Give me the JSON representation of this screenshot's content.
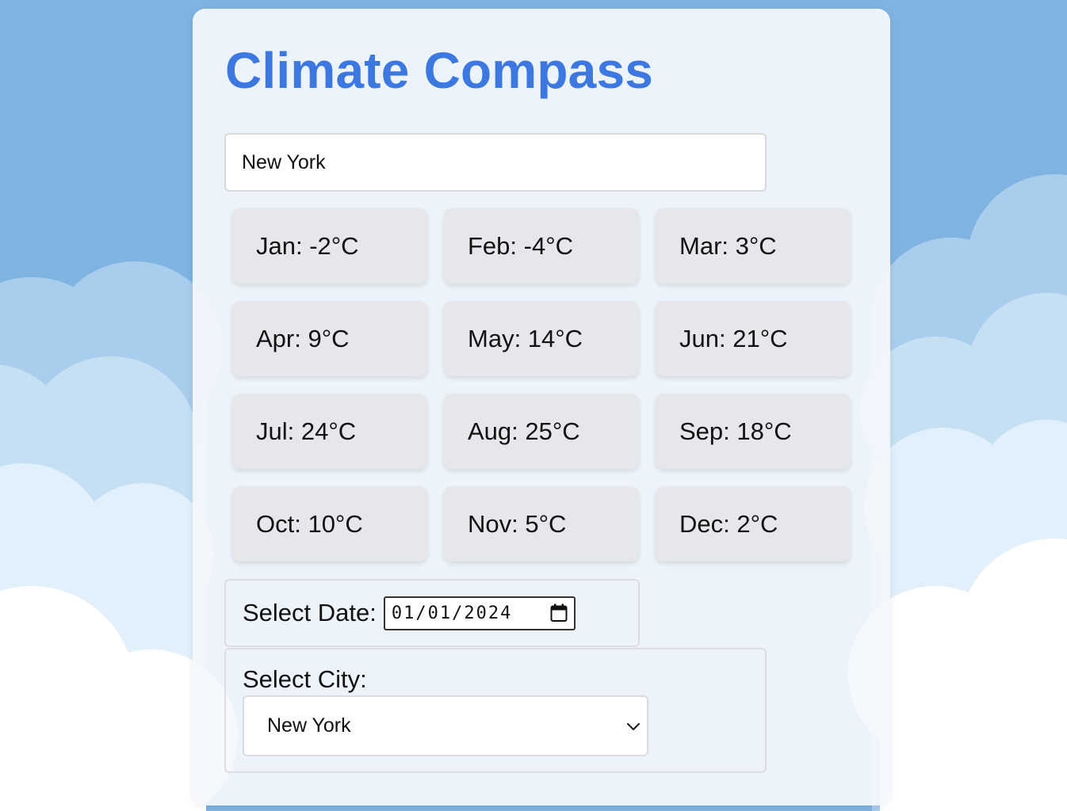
{
  "app": {
    "title": "Climate Compass"
  },
  "search": {
    "value": "New York"
  },
  "months": [
    {
      "label": "Jan: -2°C"
    },
    {
      "label": "Feb: -4°C"
    },
    {
      "label": "Mar: 3°C"
    },
    {
      "label": "Apr: 9°C"
    },
    {
      "label": "May: 14°C"
    },
    {
      "label": "Jun: 21°C"
    },
    {
      "label": "Jul: 24°C"
    },
    {
      "label": "Aug: 25°C"
    },
    {
      "label": "Sep: 18°C"
    },
    {
      "label": "Oct: 10°C"
    },
    {
      "label": "Nov: 5°C"
    },
    {
      "label": "Dec: 2°C"
    }
  ],
  "date": {
    "label": "Select Date:",
    "value": "01/01/2024"
  },
  "city": {
    "label": "Select City:",
    "selected": "New York"
  },
  "colors": {
    "accent": "#3d78e0",
    "sky": "#7fb3e2",
    "card_bg": "#f4f8fc",
    "month_bg": "#e6e7ea"
  },
  "icons": {
    "date_picker": "calendar-icon",
    "select": "chevron-down-icon"
  }
}
